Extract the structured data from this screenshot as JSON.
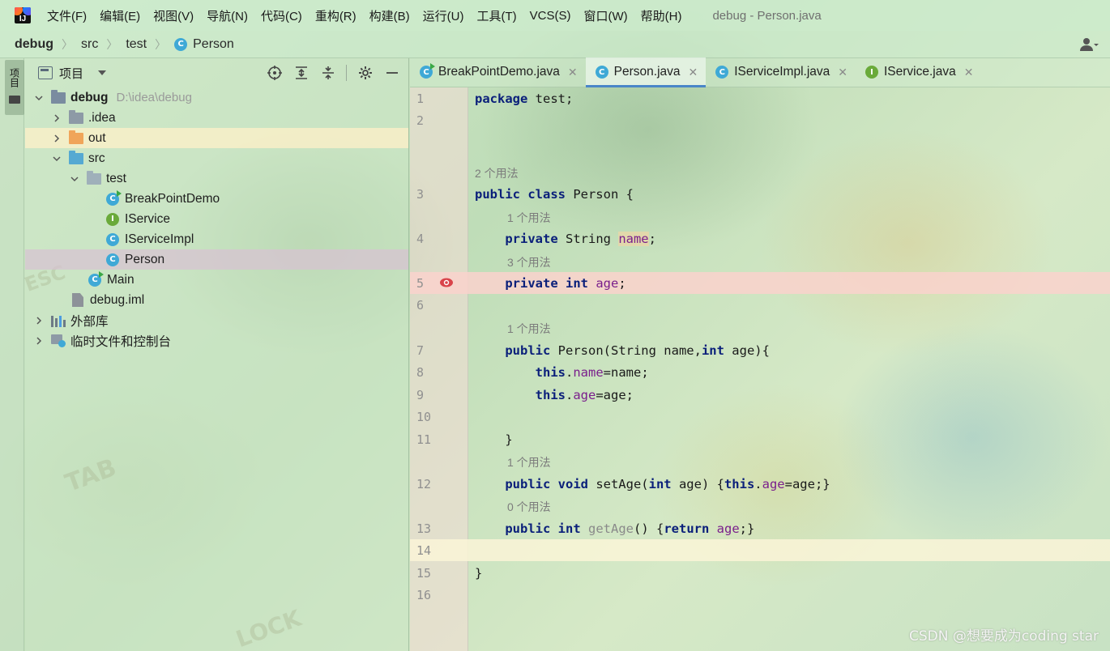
{
  "menubar": {
    "items": [
      "文件(F)",
      "编辑(E)",
      "视图(V)",
      "导航(N)",
      "代码(C)",
      "重构(R)",
      "构建(B)",
      "运行(U)",
      "工具(T)",
      "VCS(S)",
      "窗口(W)",
      "帮助(H)"
    ],
    "window_title": "debug - Person.java"
  },
  "breadcrumb": {
    "items": [
      "debug",
      "src",
      "test",
      "Person"
    ]
  },
  "tool_strip": {
    "project_tab_label": "项目"
  },
  "project_panel": {
    "title": "项目",
    "tree": [
      {
        "label": "debug",
        "path": "D:\\idea\\debug"
      },
      {
        "label": ".idea"
      },
      {
        "label": "out"
      },
      {
        "label": "src"
      },
      {
        "label": "test"
      },
      {
        "label": "BreakPointDemo"
      },
      {
        "label": "IService"
      },
      {
        "label": "IServiceImpl"
      },
      {
        "label": "Person"
      },
      {
        "label": "Main"
      },
      {
        "label": "debug.iml"
      },
      {
        "label": "外部库"
      },
      {
        "label": "临时文件和控制台"
      }
    ]
  },
  "editor": {
    "tabs": [
      {
        "label": "BreakPointDemo.java"
      },
      {
        "label": "Person.java"
      },
      {
        "label": "IServiceImpl.java"
      },
      {
        "label": "IService.java"
      }
    ],
    "hints": {
      "h3": "2 个用法",
      "h4": "1 个用法",
      "h5": "3 个用法",
      "h7": "1 个用法",
      "h12": "1 个用法",
      "h13": "0 个用法"
    },
    "line_numbers": [
      "1",
      "2",
      "3",
      "4",
      "5",
      "6",
      "7",
      "8",
      "9",
      "10",
      "11",
      "12",
      "13",
      "14",
      "15",
      "16"
    ]
  },
  "watermark": "CSDN @想要成为coding star",
  "colors": {
    "keyword": "#0a1f7a",
    "field": "#7a1f8c",
    "breakpoint": "#d9434a",
    "active_tab_underline": "#4a86c8"
  }
}
